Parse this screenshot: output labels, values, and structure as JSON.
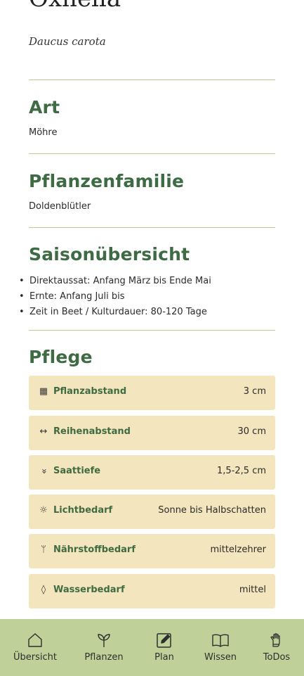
{
  "plant": {
    "name": "Oxhella",
    "latin_name": "Daucus carota"
  },
  "sections": {
    "art": {
      "title": "Art",
      "value": "Möhre"
    },
    "family": {
      "title": "Pflanzenfamilie",
      "value": "Doldenblütler"
    },
    "season": {
      "title": "Saisonübersicht",
      "items": [
        "Direktaussat: Anfang März bis Ende Mai",
        "Ernte: Anfang Juli bis",
        "Zeit in Beet / Kulturdauer: 80-120 Tage"
      ]
    },
    "care": {
      "title": "Pflege",
      "items": [
        {
          "icon": "spacing-grid-icon",
          "glyph": "▦",
          "label": "Pflanzabstand",
          "value": "3 cm"
        },
        {
          "icon": "row-distance-arrows-icon",
          "glyph": "↔",
          "label": "Reihenabstand",
          "value": "30 cm"
        },
        {
          "icon": "double-chevron-down-icon",
          "glyph": "»",
          "label": "Saattiefe",
          "value": "1,5-2,5 cm"
        },
        {
          "icon": "sun-icon",
          "glyph": "☼",
          "label": "Lichtbedarf",
          "value": "Sonne bis Halbschatten"
        },
        {
          "icon": "fork-knife-icon",
          "glyph": "ᛘ",
          "label": "Nährstoffbedarf",
          "value": "mittelzehrer"
        },
        {
          "icon": "water-drop-icon",
          "glyph": "◊",
          "label": "Wasserbedarf",
          "value": "mittel"
        }
      ]
    }
  },
  "nav": {
    "items": [
      {
        "icon": "home-icon",
        "label": "Übersicht"
      },
      {
        "icon": "sprout-icon",
        "label": "Pflanzen"
      },
      {
        "icon": "edit-icon",
        "label": "Plan"
      },
      {
        "icon": "book-icon",
        "label": "Wissen"
      },
      {
        "icon": "glove-icon",
        "label": "ToDos"
      }
    ]
  },
  "colors": {
    "heading_green": "#3e6b43",
    "divider": "#b9cc96",
    "card_bg": "#f3e5bd",
    "nav_bg": "#bfd199"
  }
}
